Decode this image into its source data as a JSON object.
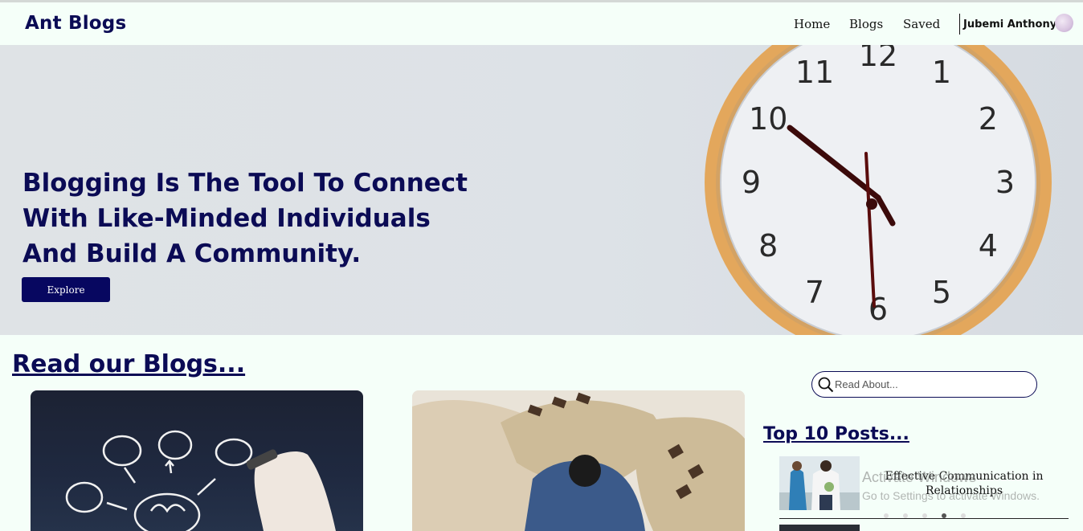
{
  "nav": {
    "brand": "Ant Blogs",
    "links": [
      "Home",
      "Blogs",
      "Saved"
    ],
    "user_name": "Jubemi Anthony"
  },
  "hero": {
    "headline": "Blogging Is The Tool To Connect With Like-Minded Individuals And Build A Community.",
    "button_label": "Explore",
    "clock_numbers": [
      "12",
      "1",
      "2",
      "3",
      "4",
      "5",
      "6",
      "7",
      "8",
      "9",
      "10",
      "11"
    ]
  },
  "blogs": {
    "section_title": "Read our Blogs..."
  },
  "sidebar": {
    "search_placeholder": "Read About...",
    "top_title": "Top 10 Posts...",
    "posts": [
      {
        "title": "Effective Communication in Relationships"
      }
    ]
  },
  "watermark": {
    "line1": "Activate Windows",
    "line2": "Go to Settings to activate Windows."
  },
  "colors": {
    "brand": "#0b0b55",
    "button": "#070760",
    "background": "#f5fff9"
  }
}
